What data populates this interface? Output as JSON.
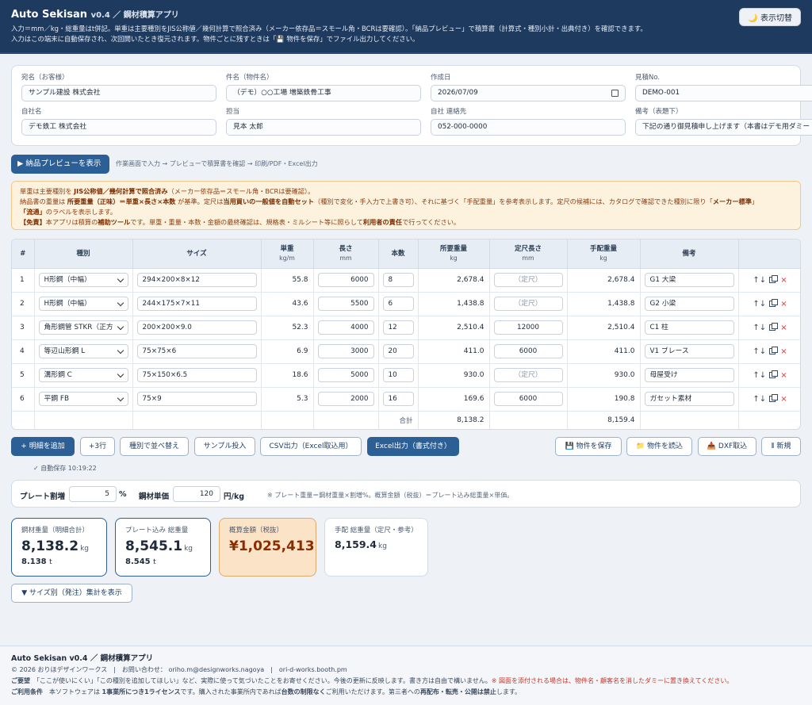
{
  "header": {
    "title": "Auto Sekisan",
    "version": "v0.4 ／ 鋼材積算アプリ",
    "desc1": "入力＝mm／kg・総重量はt併記。単重は主要種別をJIS公称値／幾何計算で照合済み（メーカー依存品＝スモール角・BCRは要確認）。「納品プレビュー」で積算書（計算式・種別小計・出典付き）を確認できます。",
    "desc2": "入力はこの端末に自動保存され、次回開いたとき復元されます。物件ごとに残すときは「💾 物件を保存」でファイル出力してください。",
    "toggle": "🌙 表示切替"
  },
  "meta": [
    {
      "label": "宛名（お客様）",
      "value": "サンプル建設 株式会社"
    },
    {
      "label": "件名（物件名）",
      "value": "（デモ）○○工場 増築鉄骨工事"
    },
    {
      "label": "作成日",
      "value": "2026/07/09"
    },
    {
      "label": "見積No.",
      "value": "DEMO-001"
    },
    {
      "label": "自社名",
      "value": "デモ鉄工 株式会社"
    },
    {
      "label": "担当",
      "value": "見本 太郎"
    },
    {
      "label": "自社 連絡先",
      "value": "052-000-0000"
    },
    {
      "label": "備考（表題下）",
      "value": "下記の通り御見積申し上げます（本書はデモ用ダミー"
    }
  ],
  "preview": {
    "button": "▶ 納品プレビューを表示",
    "hint": "作業画面で入力 → プレビューで積算書を確認 → 印刷/PDF・Excel出力"
  },
  "notice": {
    "l1a": "単重は主要種別を ",
    "l1b": "JIS公称値／幾何計算で照合済み",
    "l1c": "（メーカー依存品＝スモール角・BCRは要確認）。",
    "l2a": "納品書の重量は ",
    "l2b": "所要重量（正味）＝単重×長さ×本数",
    "l2c": " が基準。定尺は",
    "l2d": "当用買いの一般値を自動セット",
    "l2e": "（種別で変化・手入力で上書き可）、それに基づく「手配重量」を参考表示します。定尺の候補には、カタログで確認できた種別に限り「",
    "l2f": "メーカー標準",
    "l2g": "」",
    "l3a": "「流通」",
    "l3b": "のラベルを表示します。",
    "l4a": "【免責】",
    "l4b": "本アプリは積算の",
    "l4c": "補助ツール",
    "l4d": "です。単重・重量・本数・金額の最終確認は、規格表・ミルシート等に照らして",
    "l4e": "利用者の責任",
    "l4f": "で行ってください。"
  },
  "table": {
    "headers": [
      {
        "t": "#",
        "u": ""
      },
      {
        "t": "種別",
        "u": ""
      },
      {
        "t": "サイズ",
        "u": ""
      },
      {
        "t": "単重",
        "u": "kg/m"
      },
      {
        "t": "長さ",
        "u": "mm"
      },
      {
        "t": "本数",
        "u": ""
      },
      {
        "t": "所要重量",
        "u": "kg"
      },
      {
        "t": "定尺長さ",
        "u": "mm"
      },
      {
        "t": "手配重量",
        "u": "kg"
      },
      {
        "t": "備考",
        "u": ""
      },
      {
        "t": "",
        "u": ""
      }
    ],
    "rows": [
      {
        "no": "1",
        "type": "H形鋼（中幅）",
        "size": "294×200×8×12",
        "unit_w": "55.8",
        "len": "6000",
        "qty": "8",
        "req_w": "2,678.4",
        "std": "（定尺）",
        "std_set": false,
        "order_w": "2,678.4",
        "note": "G1 大梁"
      },
      {
        "no": "2",
        "type": "H形鋼（中幅）",
        "size": "244×175×7×11",
        "unit_w": "43.6",
        "len": "5500",
        "qty": "6",
        "req_w": "1,438.8",
        "std": "（定尺）",
        "std_set": false,
        "order_w": "1,438.8",
        "note": "G2 小梁"
      },
      {
        "no": "3",
        "type": "角形鋼管 STKR（正方",
        "size": "200×200×9.0",
        "unit_w": "52.3",
        "len": "4000",
        "qty": "12",
        "req_w": "2,510.4",
        "std": "12000",
        "std_set": true,
        "order_w": "2,510.4",
        "note": "C1 柱"
      },
      {
        "no": "4",
        "type": "等辺山形鋼 L",
        "size": "75×75×6",
        "unit_w": "6.9",
        "len": "3000",
        "qty": "20",
        "req_w": "411.0",
        "std": "6000",
        "std_set": true,
        "order_w": "411.0",
        "note": "V1 ブレース"
      },
      {
        "no": "5",
        "type": "溝形鋼 C",
        "size": "75×150×6.5",
        "unit_w": "18.6",
        "len": "5000",
        "qty": "10",
        "req_w": "930.0",
        "std": "（定尺）",
        "std_set": false,
        "order_w": "930.0",
        "note": "母屋受け"
      },
      {
        "no": "6",
        "type": "平鋼 FB",
        "size": "75×9",
        "unit_w": "5.3",
        "len": "2000",
        "qty": "16",
        "req_w": "169.6",
        "std": "6000",
        "std_set": true,
        "order_w": "190.8",
        "note": "ガセット素材"
      }
    ],
    "total_label": "合計",
    "total_req": "8,138.2",
    "total_order": "8,159.4",
    "ops": {
      "move": "↑↓",
      "delete": "×"
    }
  },
  "actions": {
    "add": "+ 明細を追加",
    "add3": "+3行",
    "sort": "種別で並べ替え",
    "sample": "サンプル投入",
    "csv": "CSV出力（Excel取込用）",
    "excel": "Excel出力（書式付き）",
    "save": "💾 物件を保存",
    "load": "📁 物件を読込",
    "dxf": "📥 DXF取込",
    "new": "⫴ 新規"
  },
  "autosave": "✓ 自動保存 10:19:22",
  "plate": {
    "rate_label": "プレート割増",
    "rate_value": "5",
    "rate_unit": "%",
    "price_label": "鋼材単価",
    "price_value": "120",
    "price_unit": "円/kg",
    "note": "※ プレート重量＝鋼材重量×割増%。概算金額（税抜）＝プレート込み総重量×単価。"
  },
  "summary": {
    "steel": {
      "label": "鋼材重量（明細合計）",
      "value": "8,138.2",
      "unit": "kg",
      "sub": "8.138",
      "sub_unit": "t"
    },
    "plate": {
      "label": "プレート込み 総重量",
      "value": "8,545.1",
      "unit": "kg",
      "sub": "8.545",
      "sub_unit": "t"
    },
    "amount": {
      "label": "概算金額（税抜）",
      "value": "¥1,025,413"
    },
    "hand": {
      "label": "手配 総重量（定尺・参考）",
      "value": "8,159.4",
      "unit": "kg"
    }
  },
  "size_btn": "▼ サイズ別（発注）集計を表示",
  "footer": {
    "title": "Auto Sekisan v0.4 ／ 鋼材積算アプリ",
    "copy": "© 2026 おりほデザインワークス　|　お問い合わせ： oriho.m@designworks.nagoya　|　ori-d-works.booth.pm",
    "req_label": "ご要望",
    "req_text": "「ここが使いにくい」「この種別を追加してほしい」など、実際に使って気づいたことをお寄せください。今後の更新に反映します。書き方は自由で構いません。",
    "req_warn": "※ 図面を添付される場合は、物件名・顧客名を消したダミーに置き換えてください。",
    "terms_label": "ご利用条件",
    "terms_a": "本ソフトウェアは ",
    "terms_b": "1事業所につき1ライセンス",
    "terms_c": "です。購入された事業所内であれば",
    "terms_d": "台数の制限なく",
    "terms_e": "ご利用いただけます。第三者への",
    "terms_f": "再配布・転売・公開は禁止",
    "terms_g": "します。"
  }
}
